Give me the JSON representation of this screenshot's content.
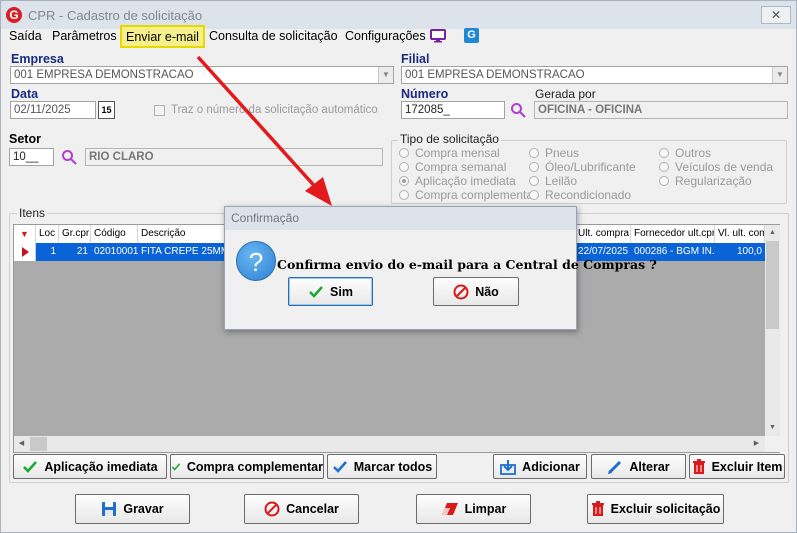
{
  "window": {
    "title": "CPR - Cadastro de solicitação",
    "close_glyph": "✕",
    "logo_glyph": "G"
  },
  "menu": {
    "items": [
      "Saída",
      "Parâmetros",
      "Enviar e-mail",
      "Consulta de solicitação",
      "Configurações"
    ],
    "icons": [
      "monitor-icon",
      "app-logo-icon"
    ]
  },
  "form": {
    "empresa_label": "Empresa",
    "empresa_value": "001 EMPRESA DEMONSTRACAO",
    "filial_label": "Filial",
    "filial_value": "001 EMPRESA DEMONSTRACAO",
    "data_label": "Data",
    "data_value": "02/11/2025",
    "calendar_glyph": "15",
    "auto_number_label": "Traz o número da solicitação automático",
    "numero_label": "Número",
    "numero_value": "172085_",
    "gerada_por_label": "Gerada por",
    "gerada_por_value": "OFICINA - OFICINA",
    "setor_label": "Setor",
    "setor_value": "10__",
    "setor_name": "RIO CLARO"
  },
  "tipo_solicitacao": {
    "title": "Tipo de solicitação",
    "options": [
      {
        "label": "Compra mensal",
        "checked": false
      },
      {
        "label": "Compra semanal",
        "checked": false
      },
      {
        "label": "Aplicação imediata",
        "checked": true
      },
      {
        "label": "Compra complementar",
        "checked": false
      },
      {
        "label": "Pneus",
        "checked": false
      },
      {
        "label": "Óleo/Lubrificante",
        "checked": false
      },
      {
        "label": "Leilão",
        "checked": false
      },
      {
        "label": "Recondicionado",
        "checked": false
      },
      {
        "label": "Outros",
        "checked": false
      },
      {
        "label": "Veículos de venda",
        "checked": false
      },
      {
        "label": "Regularização",
        "checked": false
      }
    ]
  },
  "itens": {
    "title": "Itens",
    "columns": [
      "Loc",
      "Gr.cpr",
      "Código",
      "Descrição",
      "Ult. compra",
      "Fornecedor ult.cpr",
      "Vl. ult. com"
    ],
    "rows": [
      {
        "loc": "1",
        "grcpr": "21",
        "codigo": "02010001",
        "descricao": "FITA CREPE 25MM",
        "ult_compra": "22/07/2025",
        "fornecedor": "000286 - BGM IN...",
        "vl_ult": "100,0"
      }
    ]
  },
  "item_buttons": {
    "aplicacao": "Aplicação imediata",
    "complementar": "Compra complementar",
    "marcar": "Marcar todos",
    "adicionar": "Adicionar",
    "alterar": "Alterar",
    "excluir_item": "Excluir Item"
  },
  "footer_buttons": {
    "gravar": "Gravar",
    "cancelar": "Cancelar",
    "limpar": "Limpar",
    "excluir_solicitacao": "Excluir solicitação"
  },
  "dialog": {
    "title": "Confirmação",
    "message": "Confirma envio do e-mail para a Central de Compras ?",
    "icon_glyph": "?",
    "yes_label": "Sim",
    "no_label": "Não"
  },
  "colors": {
    "accent": "#1a2a80",
    "highlight": "#f6f08a",
    "selection": "#0a64d8",
    "arrow": "#e3191c"
  }
}
